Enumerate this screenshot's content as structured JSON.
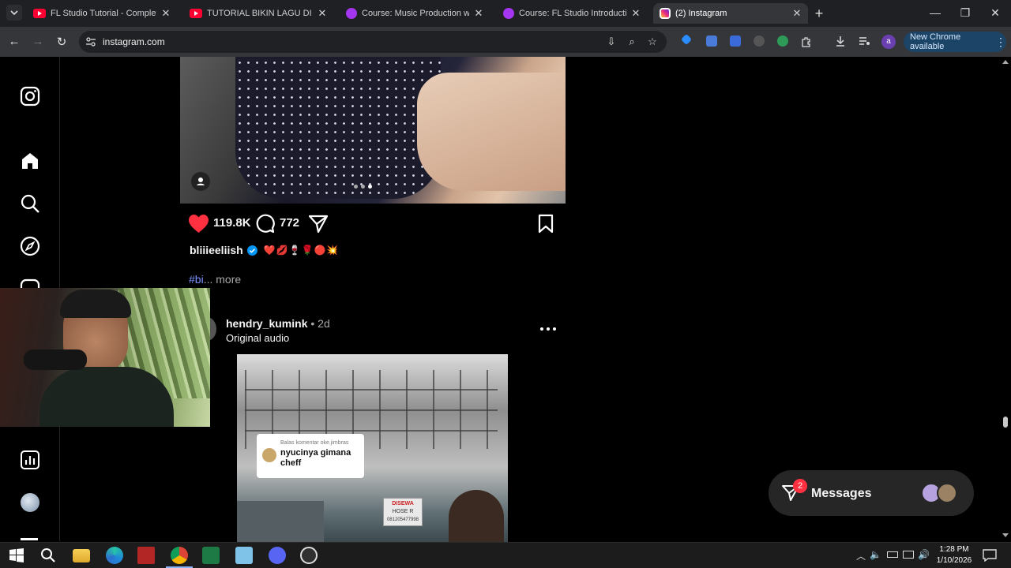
{
  "browser": {
    "tabs": [
      {
        "title": "FL Studio Tutorial - Complete M",
        "favicon": "youtube-icon",
        "active": false
      },
      {
        "title": "TUTORIAL BIKIN LAGU DI FL STU",
        "favicon": "youtube-icon",
        "active": false
      },
      {
        "title": "Course: Music Production with",
        "favicon": "udemy-icon",
        "active": false
      },
      {
        "title": "Course: FL Studio Introduction",
        "favicon": "udemy-icon",
        "active": false
      },
      {
        "title": "(2) Instagram",
        "favicon": "instagram-icon",
        "active": true
      }
    ],
    "url": "instagram.com",
    "new_chrome_label": "New Chrome available",
    "profile_initial": "a"
  },
  "post1": {
    "likes": "119.8K",
    "comments": "772",
    "username": "bliiieeliish",
    "caption_emojis": "❤️💋🍷🌹🔴💥",
    "hashtag_fragment": "#bi",
    "more_label": "... more"
  },
  "post2": {
    "username": "hendry_kumink",
    "age": "2d",
    "separator": "•",
    "audio": "Original audio",
    "options_icon": "more-options-icon",
    "comment_reply_label": "Balas komentar oke.jimbras",
    "comment_text": "nyucinya gimana cheff",
    "sign_text": "DISEWA",
    "sign_sub": "HOSE R",
    "sign_phone": "081205477998"
  },
  "messages": {
    "label": "Messages",
    "badge": "2"
  },
  "taskbar": {
    "time": "1:28 PM",
    "date": "1/10/2026"
  },
  "colors": {
    "like_red": "#ff3040",
    "verified_blue": "#0095f6",
    "link_blue": "#7a90ff",
    "chrome_dark": "#35363a"
  }
}
